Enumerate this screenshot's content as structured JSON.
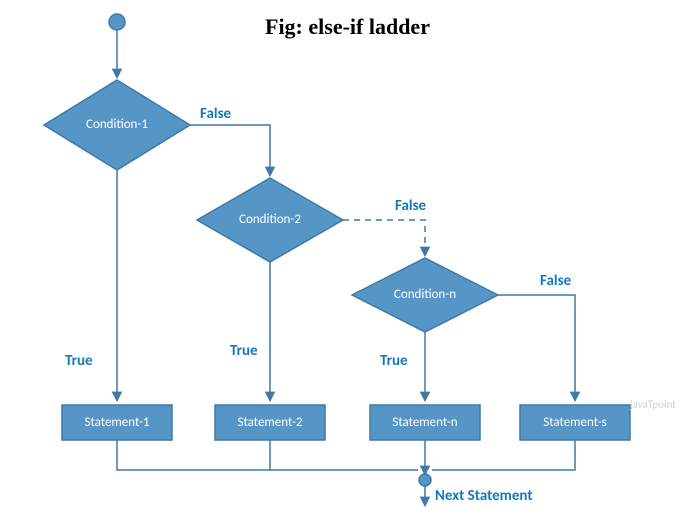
{
  "title": "Fig: else-if ladder",
  "colors": {
    "shape_fill": "#5596c7",
    "shape_stroke": "#3e7aa6",
    "line": "#3e7aa6",
    "label": "#137ab9"
  },
  "nodes": {
    "cond1": "Condition-1",
    "cond2": "Condition-2",
    "condn": "Condition-n",
    "stmt1": "Statement-1",
    "stmt2": "Statement-2",
    "stmtn": "Statement-n",
    "stmts": "Statement-s"
  },
  "edges": {
    "true": "True",
    "false": "False"
  },
  "next": "Next Statement",
  "watermark": "javaTpoint"
}
